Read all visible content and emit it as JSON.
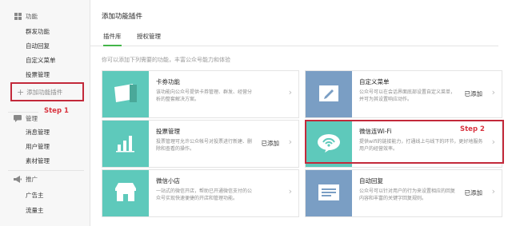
{
  "sidebar": {
    "section_function": {
      "label": "功能",
      "icon": "grid-icon"
    },
    "function_items": [
      "群发功能",
      "自动回复",
      "自定义菜单",
      "投票管理"
    ],
    "add_plugin_label": "添加功能插件",
    "section_manage": {
      "label": "管理",
      "icon": "chat-icon"
    },
    "manage_items": [
      "消息管理",
      "用户管理",
      "素材管理"
    ],
    "section_promote": {
      "label": "推广",
      "icon": "megaphone-icon"
    },
    "promote_items": [
      "广告主",
      "流量主"
    ]
  },
  "annotations": {
    "step1": "Step 1",
    "step2": "Step 2",
    "highlight_color": "#c3293a"
  },
  "main": {
    "title": "添加功能插件",
    "tabs": [
      {
        "label": "插件库",
        "active": true
      },
      {
        "label": "授权管理",
        "active": false
      }
    ],
    "description": "你可以添加下列需要的功能，丰富公众号能力和体验",
    "cards": [
      {
        "title": "卡券功能",
        "desc": "该功能向公众号提供卡券管理、群发、经营分析的整套解决方案。",
        "status": "",
        "icon": "card-icon",
        "color": "#5ec9bb"
      },
      {
        "title": "自定义菜单",
        "desc": "公众号可以在会话界面底部设置自定义菜单，并可为其设置响应动作。",
        "status": "已添加",
        "icon": "pencil-icon",
        "color": "#7a9ec4"
      },
      {
        "title": "投票管理",
        "desc": "投票管理可允许公众帐号对投票进行新建、删除和查看的操作。",
        "status": "已添加",
        "icon": "bar-chart-icon",
        "color": "#5ec9bb"
      },
      {
        "title": "微信连Wi-Fi",
        "desc": "提供wifi的链接能力，打通线上与线下的环节，更好地服务用户的经营效率。",
        "status": "",
        "icon": "wifi-icon",
        "color": "#5ec9bb"
      },
      {
        "title": "微信小店",
        "desc": "一站式的微信开店，帮助已开通微信支付的公众号实现快速便捷的开店和管理功能。",
        "status": "",
        "icon": "shop-icon",
        "color": "#5ec9bb"
      },
      {
        "title": "自动回复",
        "desc": "公众号可以针对用户的行为来设置相应的回复内容和丰富的关键字回复规则。",
        "status": "已添加",
        "icon": "reply-icon",
        "color": "#7a9ec4"
      }
    ]
  }
}
